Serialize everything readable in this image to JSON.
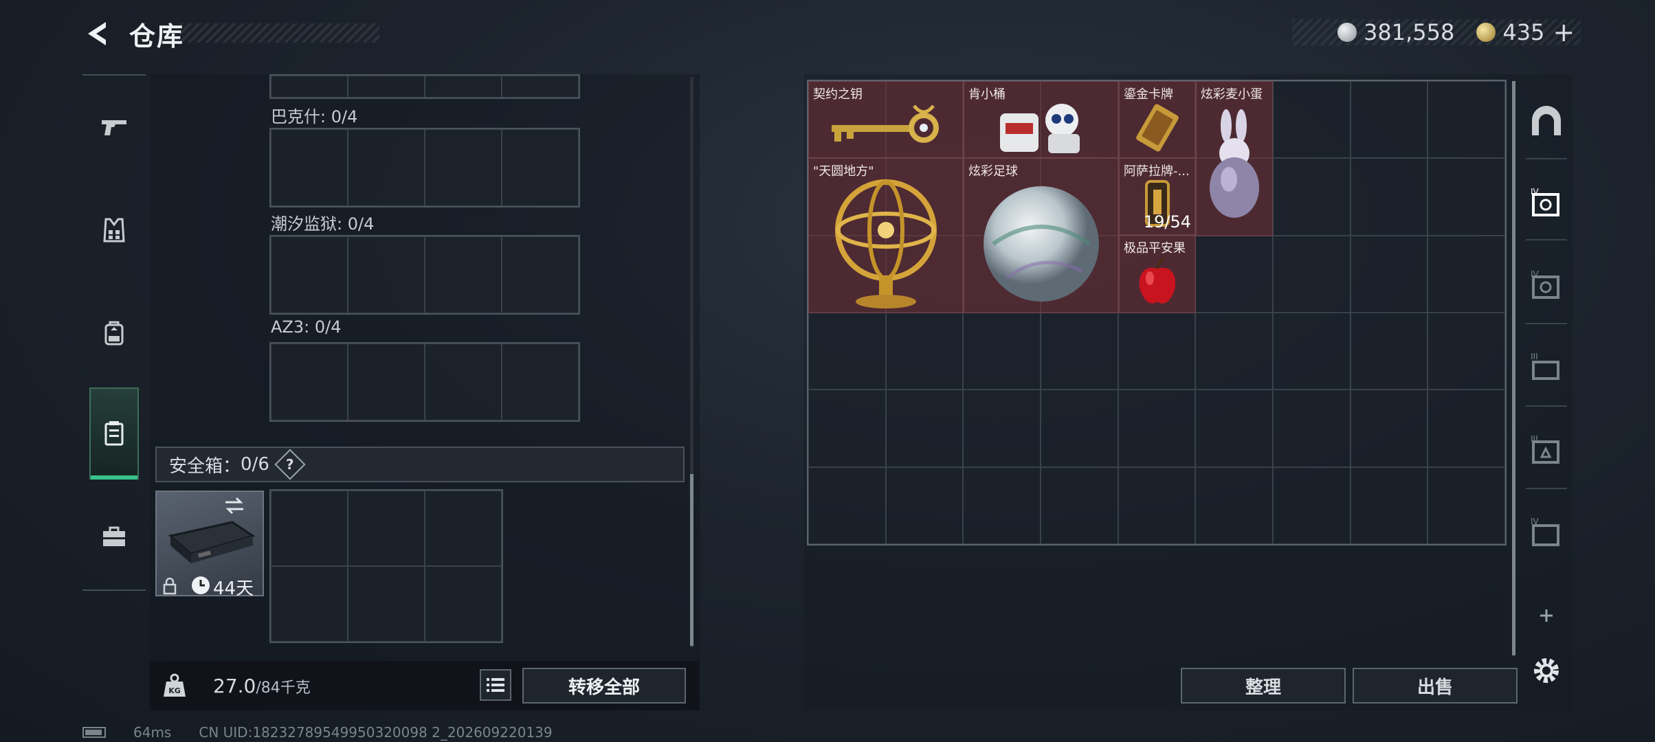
{
  "header": {
    "title": "仓库",
    "silver_amount": "381,558",
    "gold_amount": "435",
    "plus_label": "+"
  },
  "left_nav": {
    "items": [
      {
        "name": "weapons",
        "icon": "pistol-icon"
      },
      {
        "name": "armor",
        "icon": "vest-icon"
      },
      {
        "name": "backpack",
        "icon": "backpack-icon"
      },
      {
        "name": "container",
        "icon": "container-icon",
        "active": true
      },
      {
        "name": "briefcase",
        "icon": "briefcase-icon"
      }
    ]
  },
  "gun_slots": [
    {
      "label": "巴克什: 0/4"
    },
    {
      "label": "潮汐监狱: 0/4"
    },
    {
      "label": "AZ3: 0/4"
    }
  ],
  "safebox": {
    "label": "安全箱：",
    "count": "0/6",
    "help": "?",
    "days_left": "44天"
  },
  "weight": {
    "current": "27.0",
    "max": "/84千克"
  },
  "buttons": {
    "transfer_all": "转移全部",
    "tidy": "整理",
    "sell": "出售"
  },
  "stash_items": [
    {
      "name": "契约之钥",
      "art": "key"
    },
    {
      "name": "肯小桶",
      "art": "robot"
    },
    {
      "name": "鎏金卡牌",
      "art": "card"
    },
    {
      "name": "炫彩麦小蛋",
      "art": "bunny-egg"
    },
    {
      "name": "\"天圆地方\"",
      "art": "armillary"
    },
    {
      "name": "炫彩足球",
      "art": "orb"
    },
    {
      "name": "阿萨拉牌-...",
      "art": "lighter",
      "count": "19/54"
    },
    {
      "name": "极品平安果",
      "art": "apple"
    }
  ],
  "colors": {
    "accent_green": "#38c28b",
    "item_bg": "#76323a"
  },
  "status": {
    "ping": "64ms",
    "uid": "CN UID:18232789549950320098 2_202609220139"
  }
}
